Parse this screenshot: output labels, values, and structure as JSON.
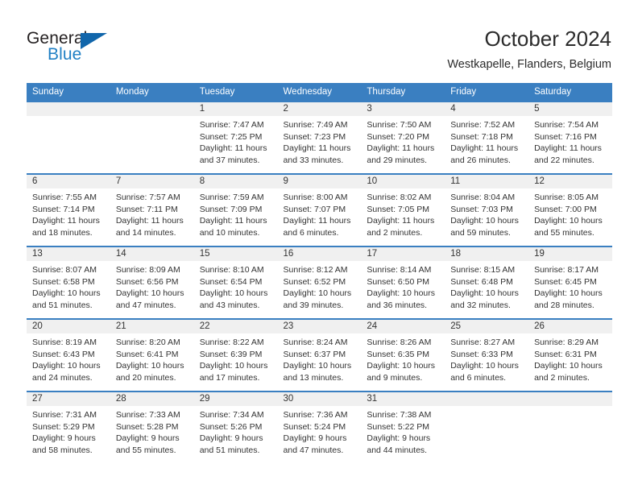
{
  "brand": {
    "name_part1": "General",
    "name_part2": "Blue",
    "icon": "triangle-logo"
  },
  "header": {
    "title": "October 2024",
    "subtitle": "Westkapelle, Flanders, Belgium"
  },
  "calendar": {
    "weekday_headers": [
      "Sunday",
      "Monday",
      "Tuesday",
      "Wednesday",
      "Thursday",
      "Friday",
      "Saturday"
    ],
    "accent_color": "#3a7fc1",
    "daynum_background": "#f0f0f0",
    "weeks": [
      [
        {
          "day": "",
          "blank": true
        },
        {
          "day": "",
          "blank": true
        },
        {
          "day": "1",
          "sunrise": "Sunrise: 7:47 AM",
          "sunset": "Sunset: 7:25 PM",
          "daylight_line1": "Daylight: 11 hours",
          "daylight_line2": "and 37 minutes."
        },
        {
          "day": "2",
          "sunrise": "Sunrise: 7:49 AM",
          "sunset": "Sunset: 7:23 PM",
          "daylight_line1": "Daylight: 11 hours",
          "daylight_line2": "and 33 minutes."
        },
        {
          "day": "3",
          "sunrise": "Sunrise: 7:50 AM",
          "sunset": "Sunset: 7:20 PM",
          "daylight_line1": "Daylight: 11 hours",
          "daylight_line2": "and 29 minutes."
        },
        {
          "day": "4",
          "sunrise": "Sunrise: 7:52 AM",
          "sunset": "Sunset: 7:18 PM",
          "daylight_line1": "Daylight: 11 hours",
          "daylight_line2": "and 26 minutes."
        },
        {
          "day": "5",
          "sunrise": "Sunrise: 7:54 AM",
          "sunset": "Sunset: 7:16 PM",
          "daylight_line1": "Daylight: 11 hours",
          "daylight_line2": "and 22 minutes."
        }
      ],
      [
        {
          "day": "6",
          "sunrise": "Sunrise: 7:55 AM",
          "sunset": "Sunset: 7:14 PM",
          "daylight_line1": "Daylight: 11 hours",
          "daylight_line2": "and 18 minutes."
        },
        {
          "day": "7",
          "sunrise": "Sunrise: 7:57 AM",
          "sunset": "Sunset: 7:11 PM",
          "daylight_line1": "Daylight: 11 hours",
          "daylight_line2": "and 14 minutes."
        },
        {
          "day": "8",
          "sunrise": "Sunrise: 7:59 AM",
          "sunset": "Sunset: 7:09 PM",
          "daylight_line1": "Daylight: 11 hours",
          "daylight_line2": "and 10 minutes."
        },
        {
          "day": "9",
          "sunrise": "Sunrise: 8:00 AM",
          "sunset": "Sunset: 7:07 PM",
          "daylight_line1": "Daylight: 11 hours",
          "daylight_line2": "and 6 minutes."
        },
        {
          "day": "10",
          "sunrise": "Sunrise: 8:02 AM",
          "sunset": "Sunset: 7:05 PM",
          "daylight_line1": "Daylight: 11 hours",
          "daylight_line2": "and 2 minutes."
        },
        {
          "day": "11",
          "sunrise": "Sunrise: 8:04 AM",
          "sunset": "Sunset: 7:03 PM",
          "daylight_line1": "Daylight: 10 hours",
          "daylight_line2": "and 59 minutes."
        },
        {
          "day": "12",
          "sunrise": "Sunrise: 8:05 AM",
          "sunset": "Sunset: 7:00 PM",
          "daylight_line1": "Daylight: 10 hours",
          "daylight_line2": "and 55 minutes."
        }
      ],
      [
        {
          "day": "13",
          "sunrise": "Sunrise: 8:07 AM",
          "sunset": "Sunset: 6:58 PM",
          "daylight_line1": "Daylight: 10 hours",
          "daylight_line2": "and 51 minutes."
        },
        {
          "day": "14",
          "sunrise": "Sunrise: 8:09 AM",
          "sunset": "Sunset: 6:56 PM",
          "daylight_line1": "Daylight: 10 hours",
          "daylight_line2": "and 47 minutes."
        },
        {
          "day": "15",
          "sunrise": "Sunrise: 8:10 AM",
          "sunset": "Sunset: 6:54 PM",
          "daylight_line1": "Daylight: 10 hours",
          "daylight_line2": "and 43 minutes."
        },
        {
          "day": "16",
          "sunrise": "Sunrise: 8:12 AM",
          "sunset": "Sunset: 6:52 PM",
          "daylight_line1": "Daylight: 10 hours",
          "daylight_line2": "and 39 minutes."
        },
        {
          "day": "17",
          "sunrise": "Sunrise: 8:14 AM",
          "sunset": "Sunset: 6:50 PM",
          "daylight_line1": "Daylight: 10 hours",
          "daylight_line2": "and 36 minutes."
        },
        {
          "day": "18",
          "sunrise": "Sunrise: 8:15 AM",
          "sunset": "Sunset: 6:48 PM",
          "daylight_line1": "Daylight: 10 hours",
          "daylight_line2": "and 32 minutes."
        },
        {
          "day": "19",
          "sunrise": "Sunrise: 8:17 AM",
          "sunset": "Sunset: 6:45 PM",
          "daylight_line1": "Daylight: 10 hours",
          "daylight_line2": "and 28 minutes."
        }
      ],
      [
        {
          "day": "20",
          "sunrise": "Sunrise: 8:19 AM",
          "sunset": "Sunset: 6:43 PM",
          "daylight_line1": "Daylight: 10 hours",
          "daylight_line2": "and 24 minutes."
        },
        {
          "day": "21",
          "sunrise": "Sunrise: 8:20 AM",
          "sunset": "Sunset: 6:41 PM",
          "daylight_line1": "Daylight: 10 hours",
          "daylight_line2": "and 20 minutes."
        },
        {
          "day": "22",
          "sunrise": "Sunrise: 8:22 AM",
          "sunset": "Sunset: 6:39 PM",
          "daylight_line1": "Daylight: 10 hours",
          "daylight_line2": "and 17 minutes."
        },
        {
          "day": "23",
          "sunrise": "Sunrise: 8:24 AM",
          "sunset": "Sunset: 6:37 PM",
          "daylight_line1": "Daylight: 10 hours",
          "daylight_line2": "and 13 minutes."
        },
        {
          "day": "24",
          "sunrise": "Sunrise: 8:26 AM",
          "sunset": "Sunset: 6:35 PM",
          "daylight_line1": "Daylight: 10 hours",
          "daylight_line2": "and 9 minutes."
        },
        {
          "day": "25",
          "sunrise": "Sunrise: 8:27 AM",
          "sunset": "Sunset: 6:33 PM",
          "daylight_line1": "Daylight: 10 hours",
          "daylight_line2": "and 6 minutes."
        },
        {
          "day": "26",
          "sunrise": "Sunrise: 8:29 AM",
          "sunset": "Sunset: 6:31 PM",
          "daylight_line1": "Daylight: 10 hours",
          "daylight_line2": "and 2 minutes."
        }
      ],
      [
        {
          "day": "27",
          "sunrise": "Sunrise: 7:31 AM",
          "sunset": "Sunset: 5:29 PM",
          "daylight_line1": "Daylight: 9 hours",
          "daylight_line2": "and 58 minutes."
        },
        {
          "day": "28",
          "sunrise": "Sunrise: 7:33 AM",
          "sunset": "Sunset: 5:28 PM",
          "daylight_line1": "Daylight: 9 hours",
          "daylight_line2": "and 55 minutes."
        },
        {
          "day": "29",
          "sunrise": "Sunrise: 7:34 AM",
          "sunset": "Sunset: 5:26 PM",
          "daylight_line1": "Daylight: 9 hours",
          "daylight_line2": "and 51 minutes."
        },
        {
          "day": "30",
          "sunrise": "Sunrise: 7:36 AM",
          "sunset": "Sunset: 5:24 PM",
          "daylight_line1": "Daylight: 9 hours",
          "daylight_line2": "and 47 minutes."
        },
        {
          "day": "31",
          "sunrise": "Sunrise: 7:38 AM",
          "sunset": "Sunset: 5:22 PM",
          "daylight_line1": "Daylight: 9 hours",
          "daylight_line2": "and 44 minutes."
        },
        {
          "day": "",
          "blank": true
        },
        {
          "day": "",
          "blank": true
        }
      ]
    ]
  }
}
